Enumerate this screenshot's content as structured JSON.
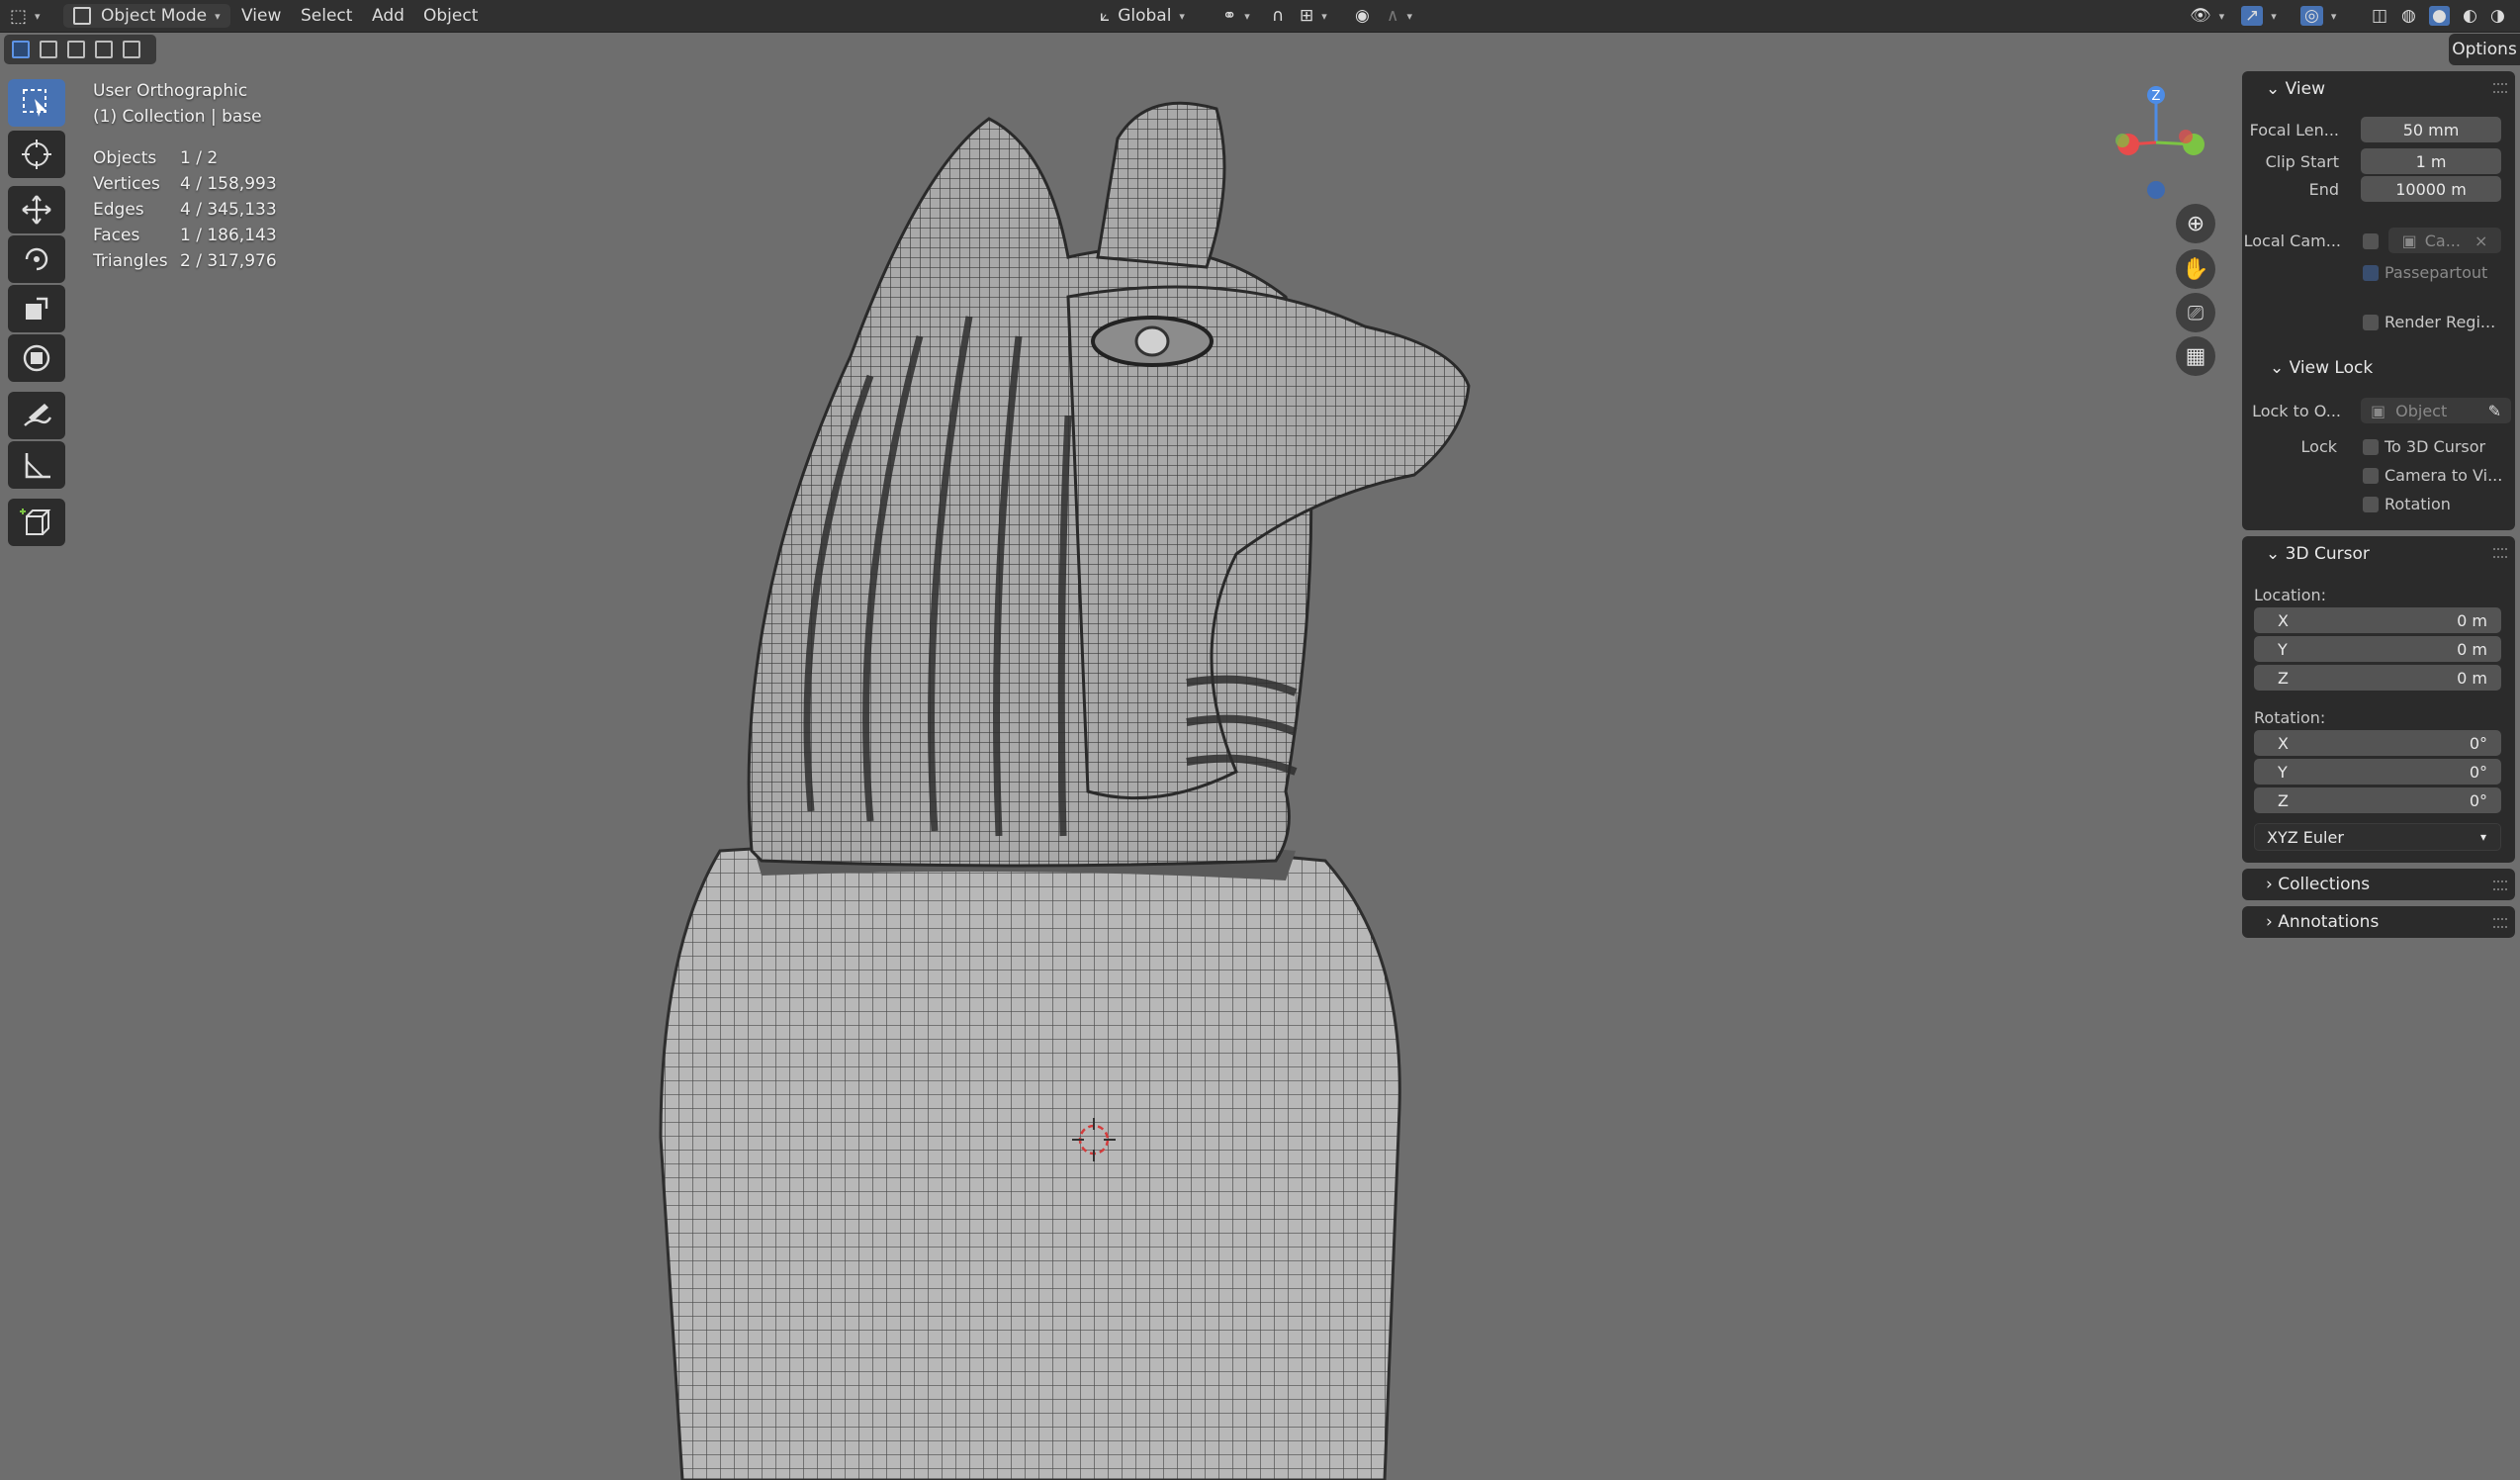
{
  "header": {
    "editor_icon": "3d-viewport-icon",
    "mode_label": "Object Mode",
    "menus": [
      "View",
      "Select",
      "Add",
      "Object"
    ],
    "orientation_label": "Global",
    "options_label": "Options"
  },
  "viewport": {
    "view_name": "User Orthographic",
    "collection_line": "(1) Collection | base",
    "stats": [
      {
        "label": "Objects",
        "value": "1 / 2"
      },
      {
        "label": "Vertices",
        "value": "4 / 158,993"
      },
      {
        "label": "Edges",
        "value": "4 / 345,133"
      },
      {
        "label": "Faces",
        "value": "1 / 186,143"
      },
      {
        "label": "Triangles",
        "value": "2 / 317,976"
      }
    ],
    "gizmo": {
      "z_label": "Z",
      "colors": {
        "x": "#e84b4b",
        "y": "#7cc443",
        "z": "#4d8ce6"
      }
    }
  },
  "toolbar": {
    "tools": [
      "select-box-icon",
      "cursor-icon",
      "move-icon",
      "rotate-icon",
      "scale-icon",
      "transform-icon",
      "annotate-icon",
      "measure-icon",
      "add-cube-icon"
    ]
  },
  "sidebar": {
    "view_panel": {
      "title": "View",
      "focal_label": "Focal Len...",
      "focal_value": "50 mm",
      "clip_start_label": "Clip Start",
      "clip_start_value": "1 m",
      "end_label": "End",
      "end_value": "10000 m",
      "local_cam_label": "Local Cam...",
      "local_cam_value": "Ca...",
      "passepartout_label": "Passepartout",
      "render_region_label": "Render Regi...",
      "view_lock_title": "View Lock",
      "lock_to_label": "Lock to O...",
      "lock_to_placeholder": "Object",
      "lock_label": "Lock",
      "to_3d_cursor_label": "To 3D Cursor",
      "camera_to_view_label": "Camera to Vi...",
      "rotation_label": "Rotation"
    },
    "cursor_panel": {
      "title": "3D Cursor",
      "location_label": "Location:",
      "location": [
        {
          "axis": "X",
          "value": "0 m"
        },
        {
          "axis": "Y",
          "value": "0 m"
        },
        {
          "axis": "Z",
          "value": "0 m"
        }
      ],
      "rotation_label": "Rotation:",
      "rotation": [
        {
          "axis": "X",
          "value": "0°"
        },
        {
          "axis": "Y",
          "value": "0°"
        },
        {
          "axis": "Z",
          "value": "0°"
        }
      ],
      "rotation_mode": "XYZ Euler"
    },
    "collections_title": "Collections",
    "annotations_title": "Annotations"
  }
}
